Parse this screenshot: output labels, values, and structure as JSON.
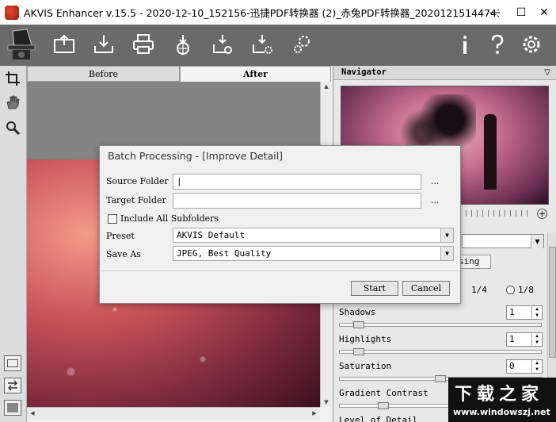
{
  "window": {
    "title": "AKVIS Enhancer v.15.5 - 2020-12-10_152156-迅捷PDF转换器 (2)_赤兔PDF转换器_20201215144743.001-Hid",
    "minimize_label": "—",
    "maximize_label": "☐",
    "close_label": "✕"
  },
  "toolbar": {
    "icons": [
      "open-image-icon",
      "save-image-icon",
      "print-icon",
      "share-web-icon",
      "batch-processing-icon",
      "batch-settings-icon",
      "preferences-icon",
      "info-icon",
      "help-icon",
      "settings-icon"
    ]
  },
  "tabs": {
    "before": "Before",
    "after": "After"
  },
  "navigator": {
    "title": "Navigator",
    "collapse_icon": "triangle-down-icon",
    "zoom_plus": "+"
  },
  "panel": {
    "tab_partial": "sing",
    "radio_quarter": "1/4",
    "radio_eighth": "1/8",
    "params": [
      {
        "label": "Shadows",
        "value": "1",
        "level": 0.07
      },
      {
        "label": "Highlights",
        "value": "1",
        "level": 0.07
      },
      {
        "label": "Saturation",
        "value": "0",
        "level": 0.5
      },
      {
        "label": "Gradient Contrast",
        "value": "",
        "level": 0.2
      },
      {
        "label": "Level of Detail",
        "value": "",
        "level": 0.5
      }
    ]
  },
  "dialog": {
    "title": "Batch Processing - [Improve Detail]",
    "source_label": "Source Folder",
    "source_value": "|",
    "target_label": "Target Folder",
    "target_value": "",
    "browse_dots": "...",
    "include_subfolders": "Include All Subfolders",
    "preset_label": "Preset",
    "preset_value": "AKVIS Default",
    "save_as_label": "Save As",
    "save_as_value": "JPEG, Best Quality",
    "start_button": "Start",
    "cancel_button": "Cancel"
  },
  "watermark": {
    "logo": "下载之家",
    "url": "www.windowszj.net"
  }
}
